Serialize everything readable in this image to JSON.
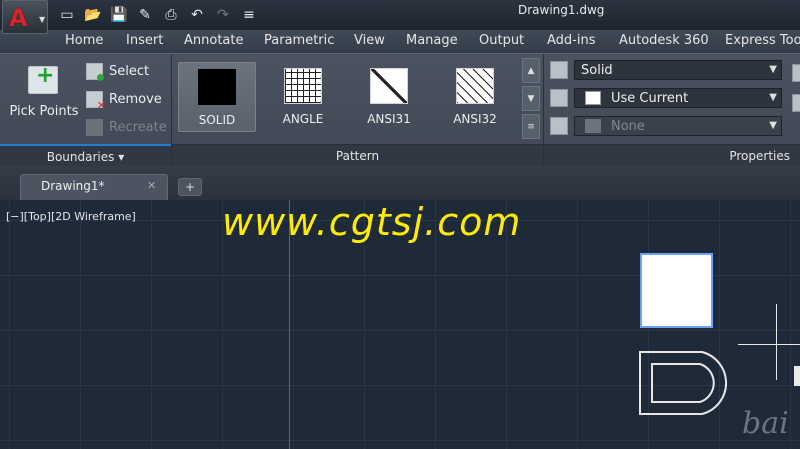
{
  "window": {
    "title": "Drawing1.dwg"
  },
  "app_menu": {
    "logo": "A"
  },
  "quick_access": {
    "icons": [
      "new-icon",
      "open-icon",
      "save-icon",
      "saveas-icon",
      "plot-icon",
      "undo-icon",
      "redo-icon",
      "customize-icon"
    ]
  },
  "menu_tabs": [
    "Home",
    "Insert",
    "Annotate",
    "Parametric",
    "View",
    "Manage",
    "Output",
    "Add-ins",
    "Autodesk 360",
    "Express Tools"
  ],
  "boundaries": {
    "title": "Boundaries",
    "pick_points": "Pick Points",
    "select": "Select",
    "remove": "Remove",
    "recreate": "Recreate"
  },
  "pattern": {
    "title": "Pattern",
    "items": [
      {
        "label": "SOLID",
        "selected": true
      },
      {
        "label": "ANGLE",
        "selected": false
      },
      {
        "label": "ANSI31",
        "selected": false
      },
      {
        "label": "ANSI32",
        "selected": false
      }
    ]
  },
  "properties": {
    "title": "Properties",
    "type": "Solid",
    "color": "Use Current",
    "background": "None"
  },
  "file_tabs": [
    {
      "label": "Drawing1*"
    }
  ],
  "viewport": {
    "label": "[−][Top][2D Wireframe]"
  },
  "watermark": {
    "text": "www.cgtsj.com",
    "logo_text": "bai"
  },
  "colors": {
    "watermark": "#ffeb00",
    "y_axis": "#2e8a2e",
    "background": "#1f2a38",
    "accent": "#1e7fd0"
  }
}
